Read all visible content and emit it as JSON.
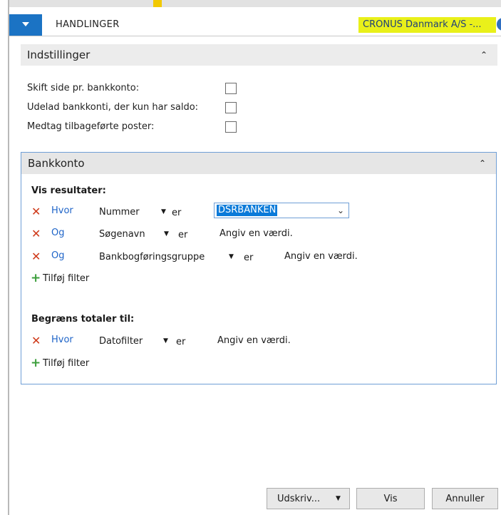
{
  "ribbon": {
    "actions_label": "HANDLINGER",
    "company": "CRONUS Danmark A/S -...",
    "help": "?"
  },
  "settings": {
    "title": "Indstillinger",
    "options": [
      {
        "label": "Skift side pr. bankkonto:",
        "checked": false
      },
      {
        "label": "Udelad bankkonti, der kun har saldo:",
        "checked": false
      },
      {
        "label": "Medtag tilbageførte poster:",
        "checked": false
      }
    ]
  },
  "bank": {
    "title": "Bankkonto",
    "results_heading": "Vis resultater:",
    "filters": [
      {
        "keyword": "Hvor",
        "field": "Nummer",
        "op": "er",
        "value": "DSRBANKEN"
      },
      {
        "keyword": "Og",
        "field": "Søgenavn",
        "op": "er",
        "value": "Angiv en værdi."
      },
      {
        "keyword": "Og",
        "field": "Bankbogføringsgruppe",
        "op": "er",
        "value": "Angiv en værdi."
      }
    ],
    "add_filter": "Tilføj filter",
    "totals_heading": "Begræns totaler til:",
    "totals_filters": [
      {
        "keyword": "Hvor",
        "field": "Datofilter",
        "op": "er",
        "value": "Angiv en værdi."
      }
    ],
    "totals_add_filter": "Tilføj filter"
  },
  "buttons": {
    "print": "Udskriv...",
    "show": "Vis",
    "cancel": "Annuller"
  },
  "colors": {
    "accent": "#1b73c4",
    "company_highlight": "#e9f01a",
    "remove": "#cf3a1a",
    "add": "#3b9e3b"
  }
}
